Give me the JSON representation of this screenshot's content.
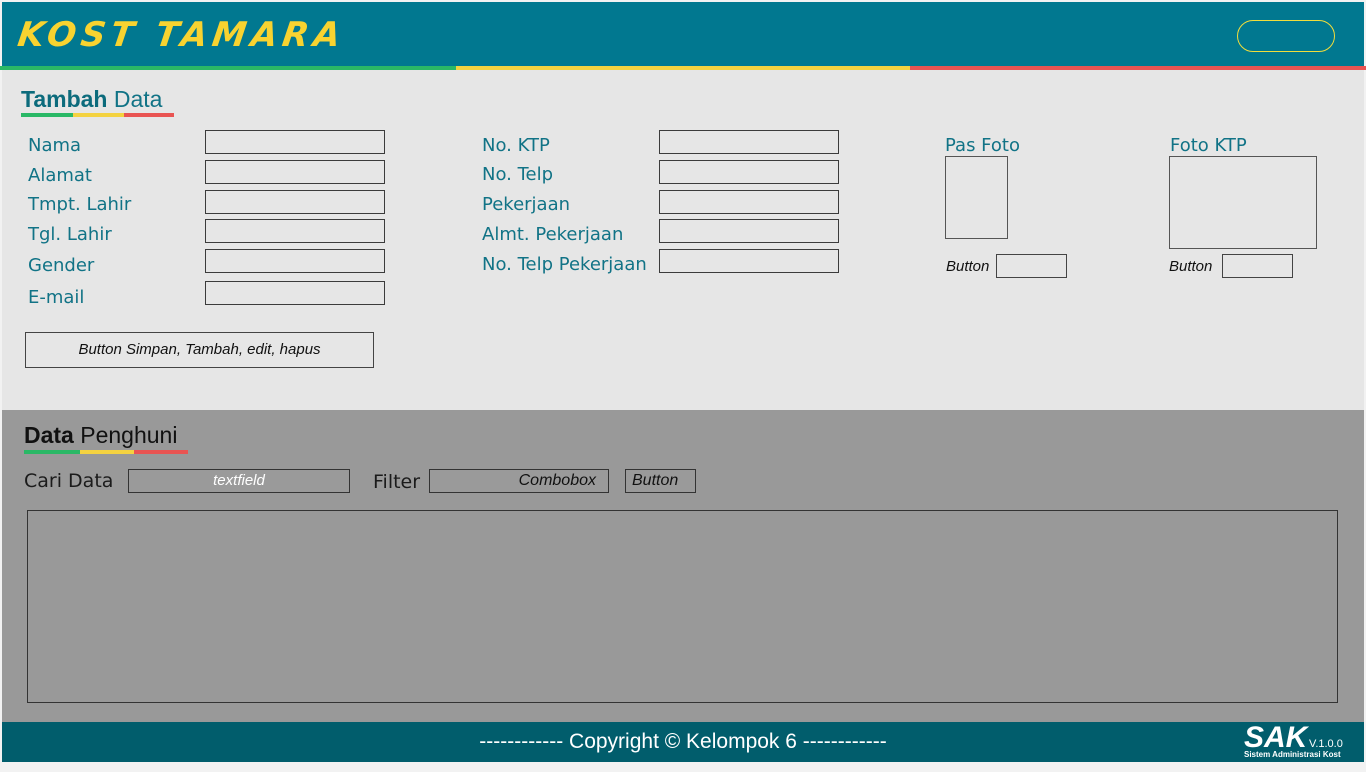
{
  "header": {
    "logo_text": "KOST TAMARA",
    "colors": {
      "bar": "#017890",
      "logo": "#f8d330",
      "stripe_green": "#2ab866",
      "stripe_yellow": "#f4d240",
      "stripe_red": "#e95452"
    }
  },
  "form": {
    "title_bold": "Tambah",
    "title_rest": "Data",
    "left_labels": [
      "Nama",
      "Alamat",
      "Tmpt. Lahir",
      "Tgl. Lahir",
      "Gender",
      "E-mail"
    ],
    "middle_labels": [
      "No. KTP",
      "No. Telp",
      "Pekerjaan",
      "Almt. Pekerjaan",
      "No. Telp Pekerjaan"
    ],
    "pas_foto_label": "Pas Foto",
    "foto_ktp_label": "Foto KTP",
    "pas_foto_button_label": "Button",
    "foto_ktp_button_label": "Button",
    "crud_button_label": "Button Simpan, Tambah, edit, hapus"
  },
  "data_section": {
    "title_bold": "Data",
    "title_rest": "Penghuni",
    "search_label": "Cari Data",
    "search_placeholder": "textfield",
    "filter_label": "Filter",
    "filter_value": "Combobox",
    "filter_button_label": "Button"
  },
  "footer": {
    "copyright": "------------ Copyright © Kelompok 6 ------------",
    "logo": "SAK",
    "version": "V.1.0.0",
    "subtitle": "Sistem Administrasi Kost"
  }
}
